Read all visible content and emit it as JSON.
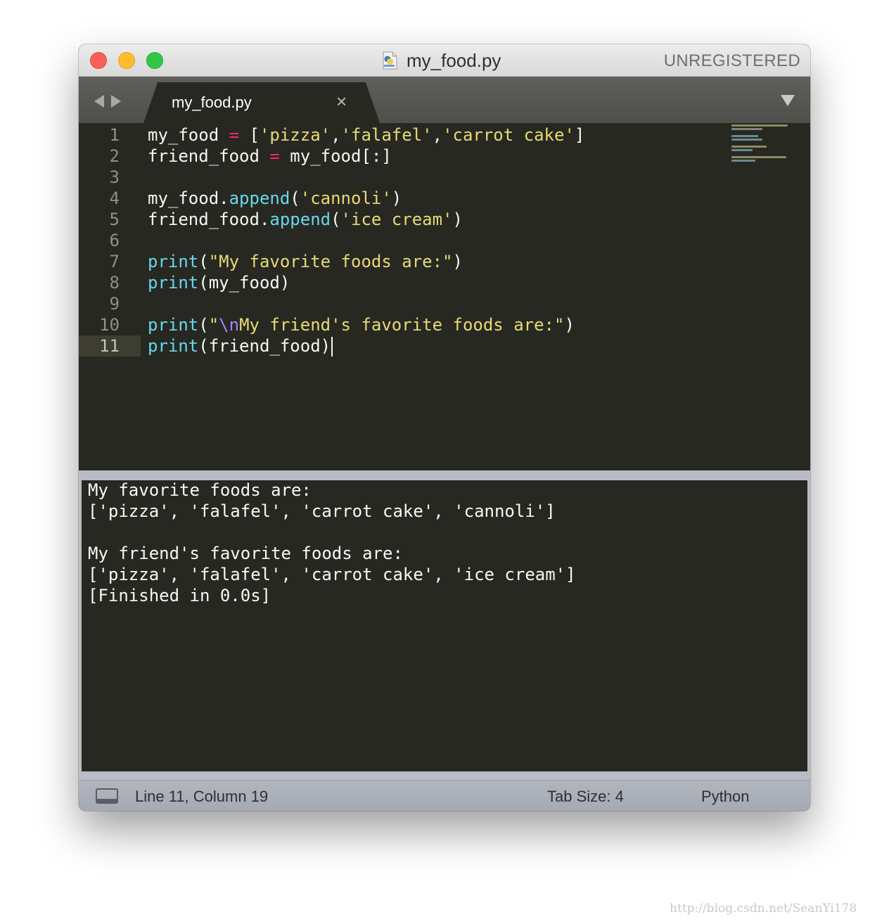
{
  "window": {
    "title": "my_food.py",
    "license_status": "UNREGISTERED",
    "file_icon": "python-file-icon"
  },
  "tabs": [
    {
      "label": "my_food.py",
      "active": true,
      "close_glyph": "×"
    }
  ],
  "editor": {
    "language": "Python",
    "current_line": 11,
    "lines": [
      {
        "num": "1",
        "tokens": [
          [
            "var",
            "my_food "
          ],
          [
            "op",
            "="
          ],
          [
            "var",
            " ["
          ],
          [
            "str",
            "'pizza'"
          ],
          [
            "var",
            ","
          ],
          [
            "str",
            "'falafel'"
          ],
          [
            "var",
            ","
          ],
          [
            "str",
            "'carrot cake'"
          ],
          [
            "var",
            "]"
          ]
        ]
      },
      {
        "num": "2",
        "tokens": [
          [
            "var",
            "friend_food "
          ],
          [
            "op",
            "="
          ],
          [
            "var",
            " my_food[:]"
          ]
        ]
      },
      {
        "num": "3",
        "tokens": []
      },
      {
        "num": "4",
        "tokens": [
          [
            "var",
            "my_food."
          ],
          [
            "fn",
            "append"
          ],
          [
            "var",
            "("
          ],
          [
            "str",
            "'cannoli'"
          ],
          [
            "var",
            ")"
          ]
        ]
      },
      {
        "num": "5",
        "tokens": [
          [
            "var",
            "friend_food."
          ],
          [
            "fn",
            "append"
          ],
          [
            "var",
            "("
          ],
          [
            "str",
            "'ice cream'"
          ],
          [
            "var",
            ")"
          ]
        ]
      },
      {
        "num": "6",
        "tokens": []
      },
      {
        "num": "7",
        "tokens": [
          [
            "fn",
            "print"
          ],
          [
            "var",
            "("
          ],
          [
            "str",
            "\"My favorite foods are:\""
          ],
          [
            "var",
            ")"
          ]
        ]
      },
      {
        "num": "8",
        "tokens": [
          [
            "fn",
            "print"
          ],
          [
            "var",
            "(my_food)"
          ]
        ]
      },
      {
        "num": "9",
        "tokens": []
      },
      {
        "num": "10",
        "tokens": [
          [
            "fn",
            "print"
          ],
          [
            "var",
            "("
          ],
          [
            "str",
            "\""
          ],
          [
            "esc",
            "\\n"
          ],
          [
            "str",
            "My friend's favorite foods are:\""
          ],
          [
            "var",
            ")"
          ]
        ]
      },
      {
        "num": "11",
        "tokens": [
          [
            "fn",
            "print"
          ],
          [
            "var",
            "(friend_food)"
          ]
        ]
      }
    ]
  },
  "output": {
    "lines": [
      "My favorite foods are:",
      "['pizza', 'falafel', 'carrot cake', 'cannoli']",
      "",
      "My friend's favorite foods are:",
      "['pizza', 'falafel', 'carrot cake', 'ice cream']",
      "[Finished in 0.0s]"
    ]
  },
  "status": {
    "position": "Line 11, Column 19",
    "tab_size": "Tab Size: 4",
    "syntax": "Python"
  },
  "watermark": "http://blog.csdn.net/SeanYi178",
  "colors": {
    "background": "#272822",
    "keyword_operator": "#f92672",
    "string": "#e6db74",
    "function": "#66d9ef",
    "escape": "#ae81ff",
    "text": "#f8f8f2"
  }
}
